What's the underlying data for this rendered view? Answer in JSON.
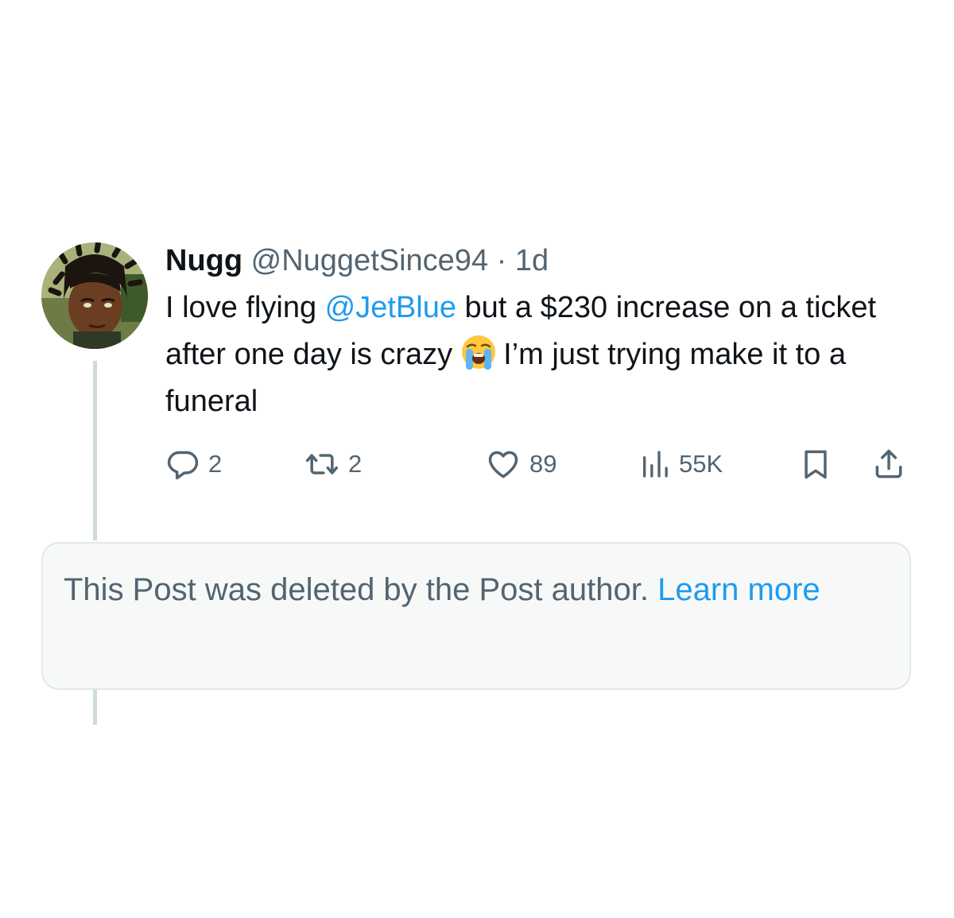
{
  "post": {
    "author_name": "Nugg",
    "handle": "@NuggetSince94",
    "separator": "·",
    "time": "1d",
    "text_part1": "I love flying ",
    "mention": "@JetBlue",
    "text_part2": " but a $230 increase on a ticket after one day is crazy",
    "emoji_name": "loudly-crying-face-emoji",
    "text_part3": "I’m just trying make it to a funeral"
  },
  "actions": {
    "replies": "2",
    "reposts": "2",
    "likes": "89",
    "views": "55K",
    "icons": [
      "reply-icon",
      "repost-icon",
      "like-icon",
      "views-icon",
      "bookmark-icon",
      "share-icon"
    ]
  },
  "deleted_notice": {
    "text": "This Post was deleted by the Post author.",
    "link_label": "Learn more"
  },
  "colors": {
    "text": "#0f1419",
    "secondary": "#536471",
    "accent": "#1d9bf0",
    "thread_line": "#cfd9de",
    "card_bg": "#f7f9f9",
    "card_border": "#e2e7ea"
  }
}
